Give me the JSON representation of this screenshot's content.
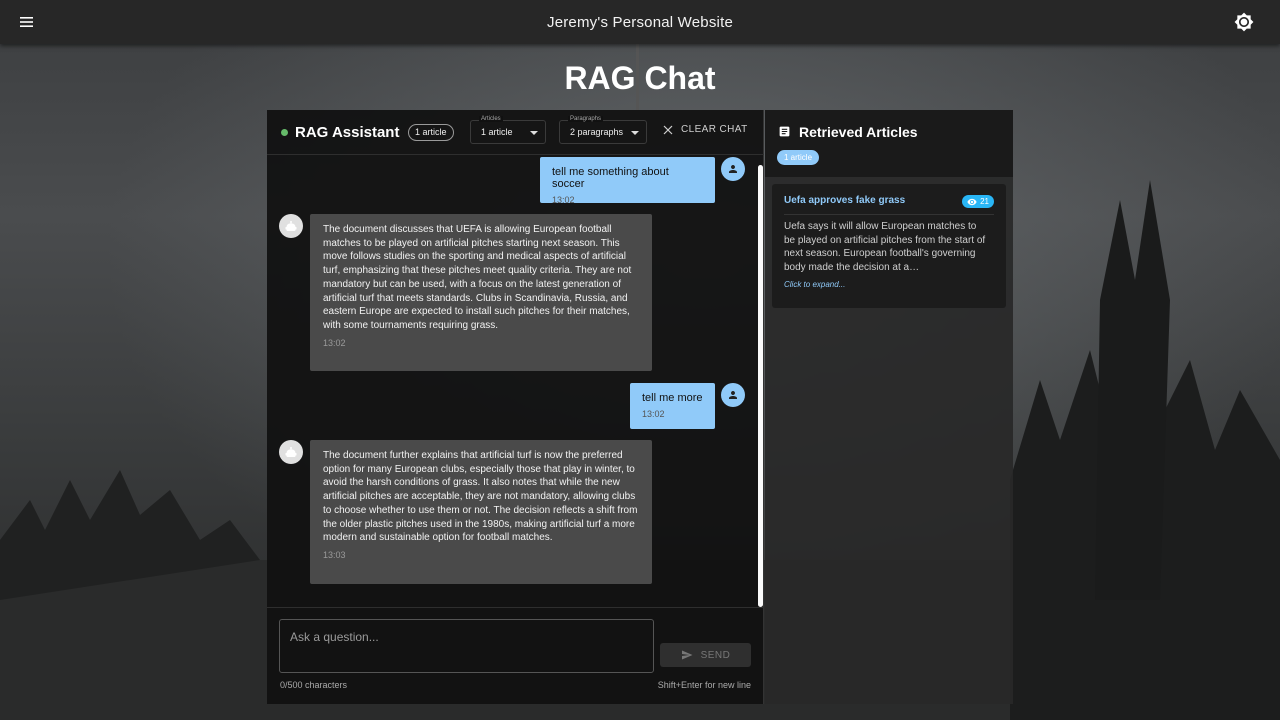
{
  "site": {
    "title": "Jeremy's Personal Website"
  },
  "page": {
    "title": "RAG Chat"
  },
  "chat": {
    "assistant_name": "RAG Assistant",
    "article_chip": "1 article",
    "articles_select": {
      "label": "Articles",
      "value": "1 article"
    },
    "paragraphs_select": {
      "label": "Paragraphs",
      "value": "2 paragraphs"
    },
    "clear_label": "CLEAR CHAT",
    "messages": [
      {
        "role": "user",
        "text": "tell me something about soccer",
        "time": "13:02"
      },
      {
        "role": "assistant",
        "text": "The document discusses that UEFA is allowing European football matches to be played on artificial pitches starting next season. This move follows studies on the sporting and medical aspects of artificial turf, emphasizing that these pitches meet quality criteria. They are not mandatory but can be used, with a focus on the latest generation of artificial turf that meets standards. Clubs in Scandinavia, Russia, and eastern Europe are expected to install such pitches for their matches, with some tournaments requiring grass.",
        "time": "13:02"
      },
      {
        "role": "user",
        "text": "tell me more",
        "time": "13:02"
      },
      {
        "role": "assistant",
        "text": "The document further explains that artificial turf is now the preferred option for many European clubs, especially those that play in winter, to avoid the harsh conditions of grass. It also notes that while the new artificial pitches are acceptable, they are not mandatory, allowing clubs to choose whether to use them or not. The decision reflects a shift from the older plastic pitches used in the 1980s, making artificial turf a more modern and sustainable option for football matches.",
        "time": "13:03"
      }
    ],
    "input": {
      "placeholder": "Ask a question...",
      "value": ""
    },
    "send_label": "SEND",
    "char_count": "0/500 characters",
    "hint": "Shift+Enter for new line"
  },
  "articles": {
    "title": "Retrieved Articles",
    "count_label": "1 article",
    "items": [
      {
        "title": "Uefa approves fake grass",
        "views": "21",
        "excerpt": "Uefa says it will allow European matches to be played on artificial pitches from the start of next season. European football's governing body made the decision at a…",
        "expand_label": "Click to expand..."
      }
    ]
  },
  "colors": {
    "accent": "#90caf9",
    "status": "#66bb6a",
    "views_badge": "#29b6f6"
  },
  "icons": [
    "menu-icon",
    "brightness-icon",
    "close-icon",
    "send-icon",
    "person-icon",
    "bot-icon",
    "article-icon",
    "eye-icon"
  ]
}
